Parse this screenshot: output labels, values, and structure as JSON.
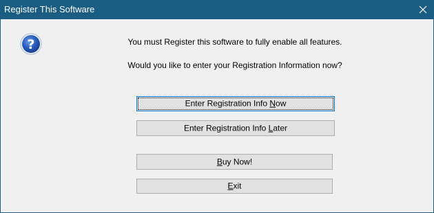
{
  "window": {
    "title": "Register This Software",
    "close_glyph": "close-icon"
  },
  "icon": {
    "name": "question-icon",
    "glyph": "?",
    "color": "#1e4fa8"
  },
  "message": {
    "line1": "You must Register this software to fully enable all features.",
    "line2": "Would you like to enter your Registration Information now?"
  },
  "buttons": {
    "now": {
      "before": "Enter Registration Info ",
      "mnemonic": "N",
      "after": "ow"
    },
    "later": {
      "before": "Enter Registration Info ",
      "mnemonic": "L",
      "after": "ater"
    },
    "buy": {
      "before": "",
      "mnemonic": "B",
      "after": "uy Now!"
    },
    "exit": {
      "before": "",
      "mnemonic": "E",
      "after": "xit"
    }
  },
  "colors": {
    "titlebar": "#1b5d82",
    "background": "#f0f0f0",
    "button_face": "#e1e1e1",
    "focus_border": "#0078d7"
  }
}
